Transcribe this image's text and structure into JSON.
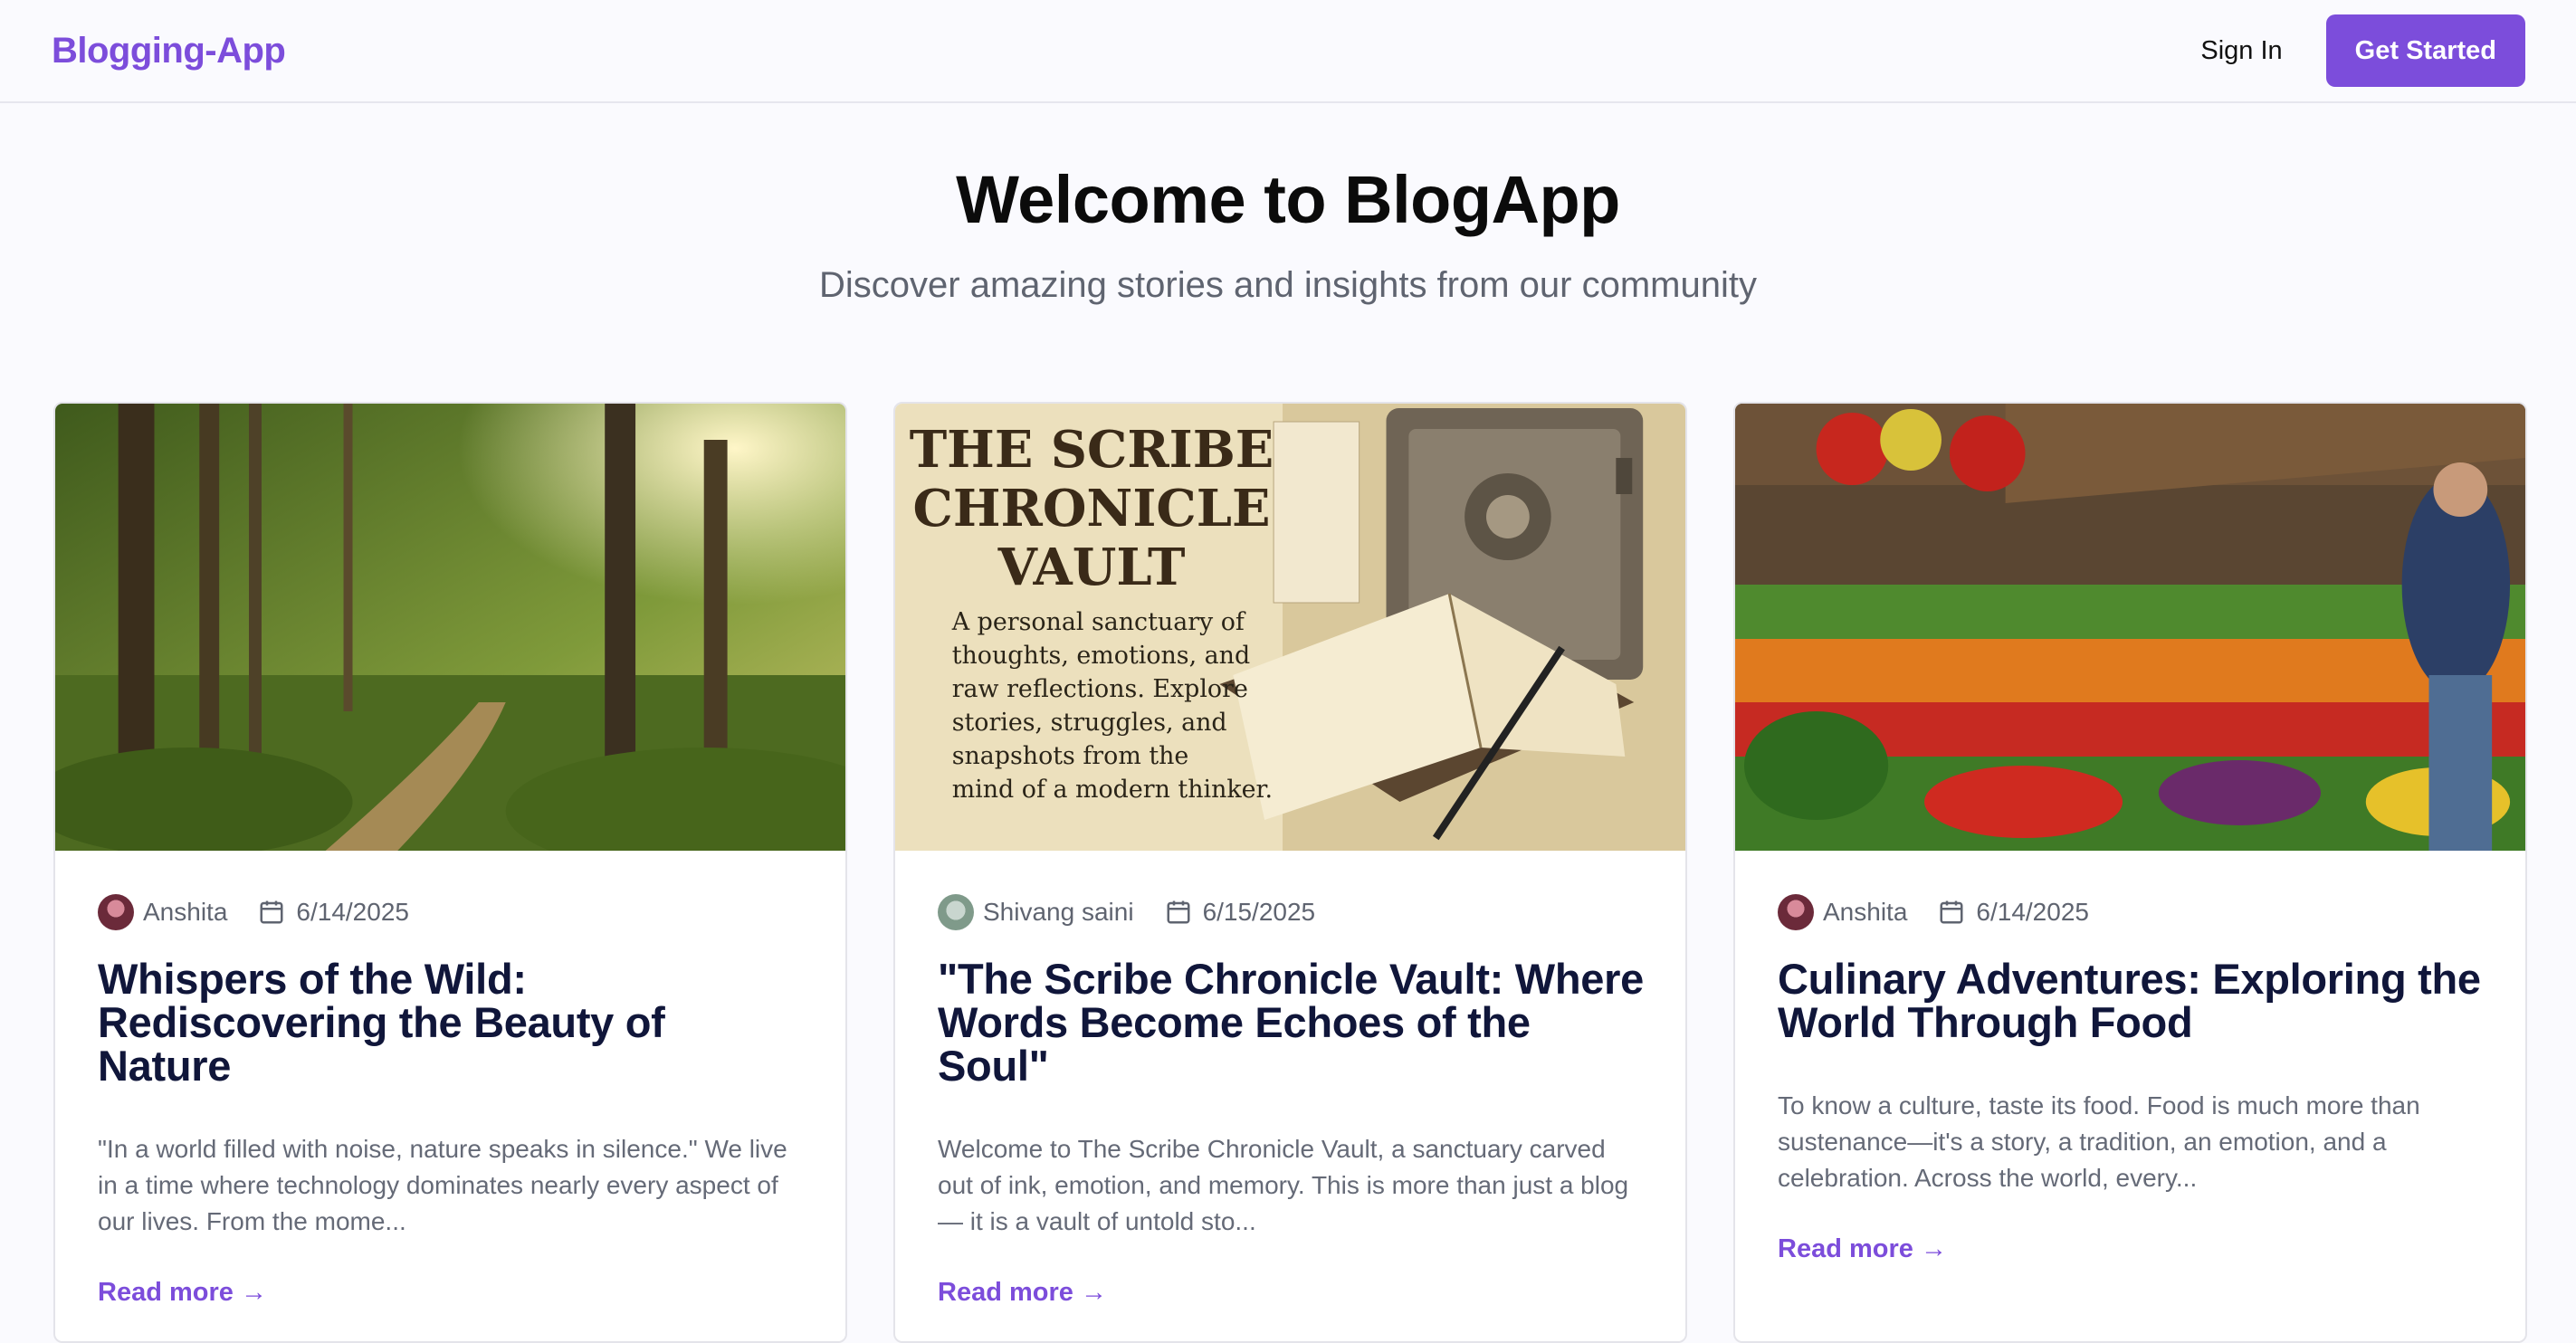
{
  "header": {
    "brand": "Blogging-App",
    "sign_in": "Sign In",
    "get_started": "Get Started"
  },
  "hero": {
    "title": "Welcome to BlogApp",
    "subtitle": "Discover amazing stories and insights from our community"
  },
  "colors": {
    "accent": "#7c4ddb",
    "title": "#10163a",
    "muted": "#5f6470"
  },
  "posts": [
    {
      "author": "Anshita",
      "date": "6/14/2025",
      "title": "Whispers of the Wild: Rediscovering the Beauty of Nature",
      "excerpt": "\"In a world filled with noise, nature speaks in silence.\" We live in a time where technology dominates nearly every aspect of our lives. From the mome...",
      "read_more": "Read more →",
      "image": "forest-path-image"
    },
    {
      "author": "Shivang saini",
      "date": "6/15/2025",
      "title": "\"The Scribe Chronicle Vault: Where Words Become Echoes of the Soul\"",
      "excerpt": "Welcome to The Scribe Chronicle Vault, a sanctuary carved out of ink, emotion, and memory. This is more than just a blog — it is a vault of untold sto...",
      "read_more": "Read more →",
      "image": "scribe-vault-image",
      "image_text": {
        "heading": [
          "THE SCRIBE",
          "CHRONICLE",
          "VAULT"
        ],
        "body": [
          "A personal sanctuary of",
          "thoughts, emotions, and",
          "raw reflections. Explore",
          "stories, struggles, and",
          "snapshots from the",
          "mind of a modern thinker."
        ]
      }
    },
    {
      "author": "Anshita",
      "date": "6/14/2025",
      "title": "Culinary Adventures: Exploring the World Through Food",
      "excerpt": "To know a culture, taste its food. Food is much more than sustenance—it's a story, a tradition, an emotion, and a celebration. Across the world, every...",
      "read_more": "Read more →",
      "image": "market-produce-image"
    }
  ]
}
